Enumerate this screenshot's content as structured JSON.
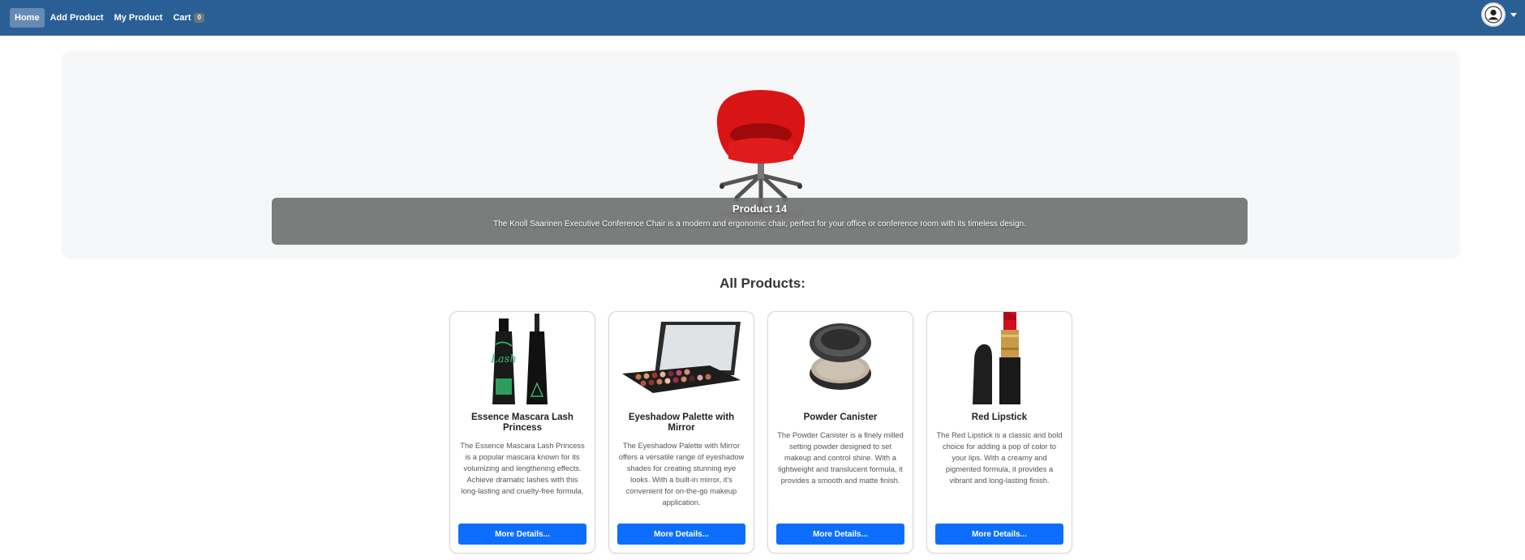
{
  "nav": {
    "home": "Home",
    "add_product": "Add Product",
    "my_product": "My Product",
    "cart": "Cart",
    "cart_count": "0"
  },
  "hero": {
    "title": "Product 14",
    "description": "The Knoll Saarinen Executive Conference Chair is a modern and ergonomic chair, perfect for your office or conference room with its timeless design."
  },
  "section_title": "All Products:",
  "products": [
    {
      "title": "Essence Mascara Lash Princess",
      "description": "The Essence Mascara Lash Princess is a popular mascara known for its volumizing and lengthening effects. Achieve dramatic lashes with this long-lasting and cruelty-free formula.",
      "button": "More Details..."
    },
    {
      "title": "Eyeshadow Palette with Mirror",
      "description": "The Eyeshadow Palette with Mirror offers a versatile range of eyeshadow shades for creating stunning eye looks. With a built-in mirror, it's convenient for on-the-go makeup application.",
      "button": "More Details..."
    },
    {
      "title": "Powder Canister",
      "description": "The Powder Canister is a finely milled setting powder designed to set makeup and control shine. With a lightweight and translucent formula, it provides a smooth and matte finish.",
      "button": "More Details..."
    },
    {
      "title": "Red Lipstick",
      "description": "The Red Lipstick is a classic and bold choice for adding a pop of color to your lips. With a creamy and pigmented formula, it provides a vibrant and long-lasting finish.",
      "button": "More Details..."
    }
  ],
  "colors": {
    "navbar": "#2a5f96",
    "button": "#0d6efd"
  }
}
